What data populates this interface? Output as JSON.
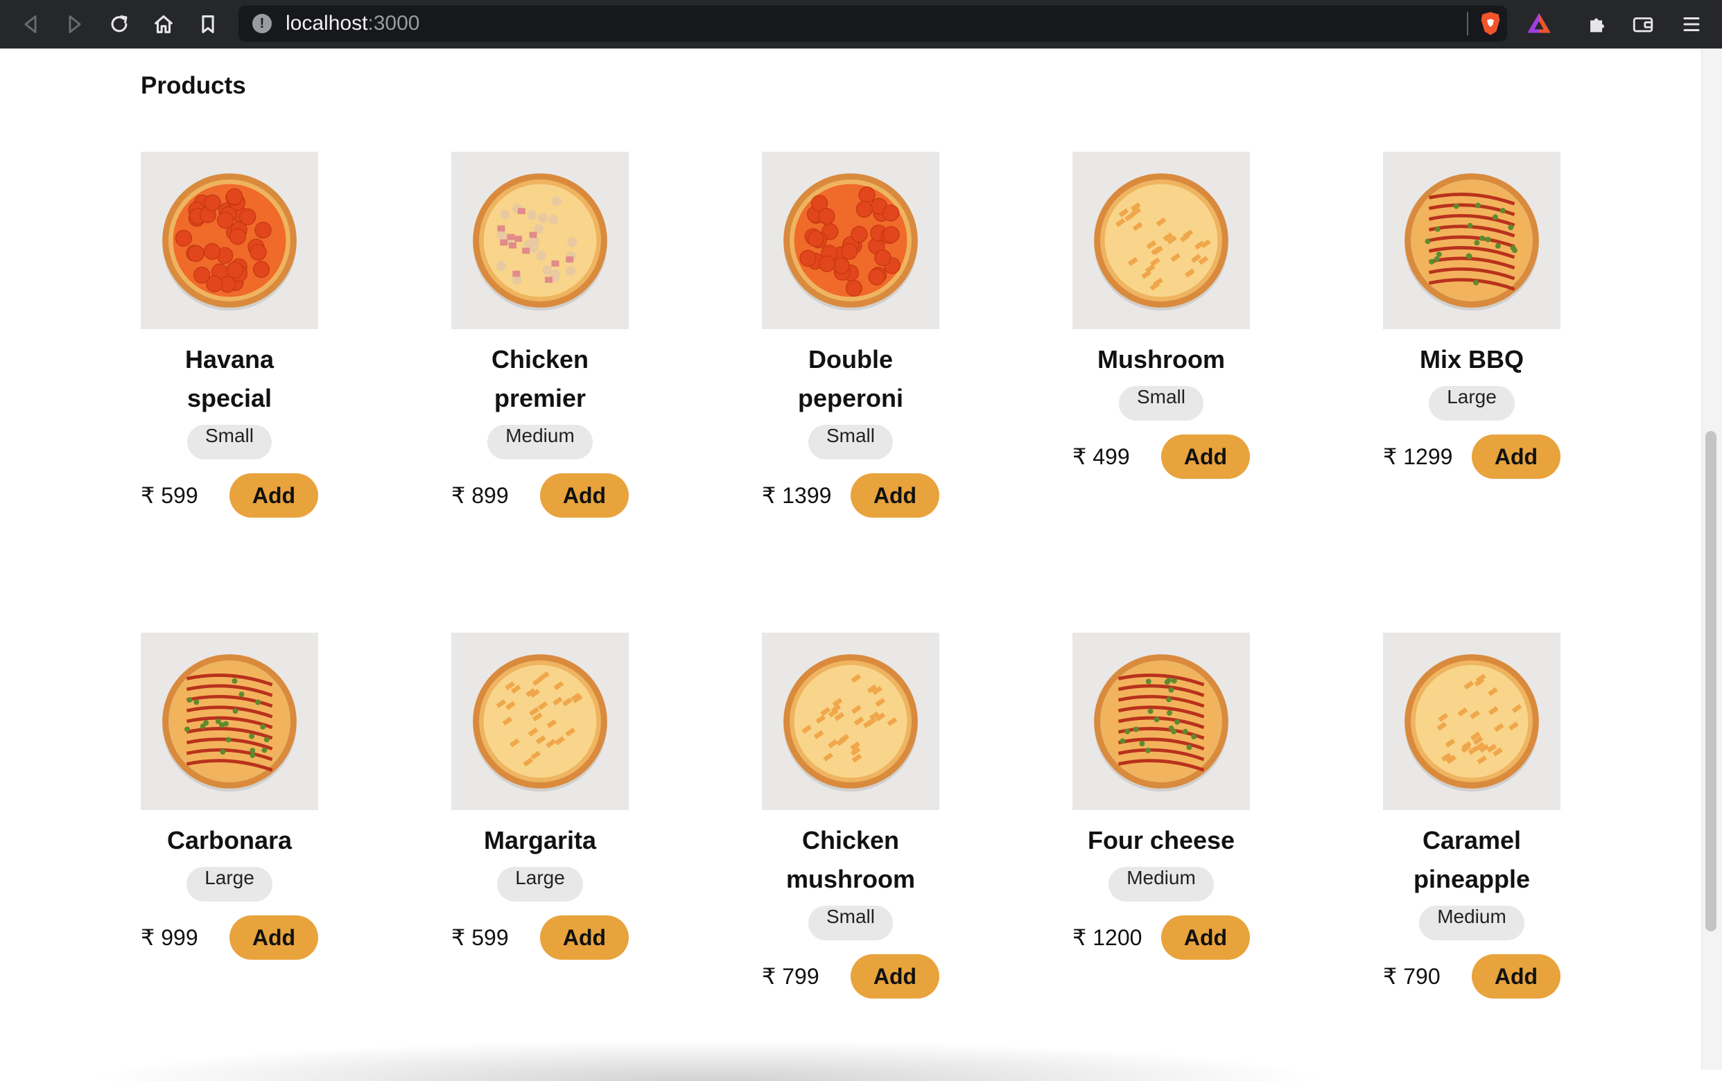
{
  "browser": {
    "url_host": "localhost",
    "url_port": ":3000",
    "icons": [
      "back-icon",
      "forward-icon",
      "reload-icon",
      "home-icon",
      "bookmark-icon",
      "site-info-icon",
      "brave-shields-icon",
      "brave-rewards-icon",
      "extensions-icon",
      "wallet-icon",
      "menu-icon"
    ]
  },
  "page": {
    "title": "Products"
  },
  "products": [
    {
      "name": "Havana special",
      "size": "Small",
      "price": "₹ 599",
      "add": "Add",
      "topping": "pepperoni"
    },
    {
      "name": "Chicken premier",
      "size": "Medium",
      "price": "₹ 899",
      "add": "Add",
      "topping": "chicken"
    },
    {
      "name": "Double peperoni",
      "size": "Small",
      "price": "₹ 1399",
      "add": "Add",
      "topping": "pepperoni"
    },
    {
      "name": "Mushroom",
      "size": "Small",
      "price": "₹ 499",
      "add": "Add",
      "topping": "cheese"
    },
    {
      "name": "Mix BBQ",
      "size": "Large",
      "price": "₹ 1299",
      "add": "Add",
      "topping": "bbq"
    },
    {
      "name": "Carbonara",
      "size": "Large",
      "price": "₹ 999",
      "add": "Add",
      "topping": "bbq"
    },
    {
      "name": "Margarita",
      "size": "Large",
      "price": "₹ 599",
      "add": "Add",
      "topping": "cheese"
    },
    {
      "name": "Chicken mushroom",
      "size": "Small",
      "price": "₹ 799",
      "add": "Add",
      "topping": "cheese"
    },
    {
      "name": "Four cheese",
      "size": "Medium",
      "price": "₹ 1200",
      "add": "Add",
      "topping": "bbq"
    },
    {
      "name": "Caramel pineapple",
      "size": "Medium",
      "price": "₹ 790",
      "add": "Add",
      "topping": "cheese"
    }
  ],
  "colors": {
    "add_button": "#e8a33c",
    "size_badge": "#e8e8e8",
    "toolbar": "#26272b",
    "urlbar": "#17181b"
  }
}
